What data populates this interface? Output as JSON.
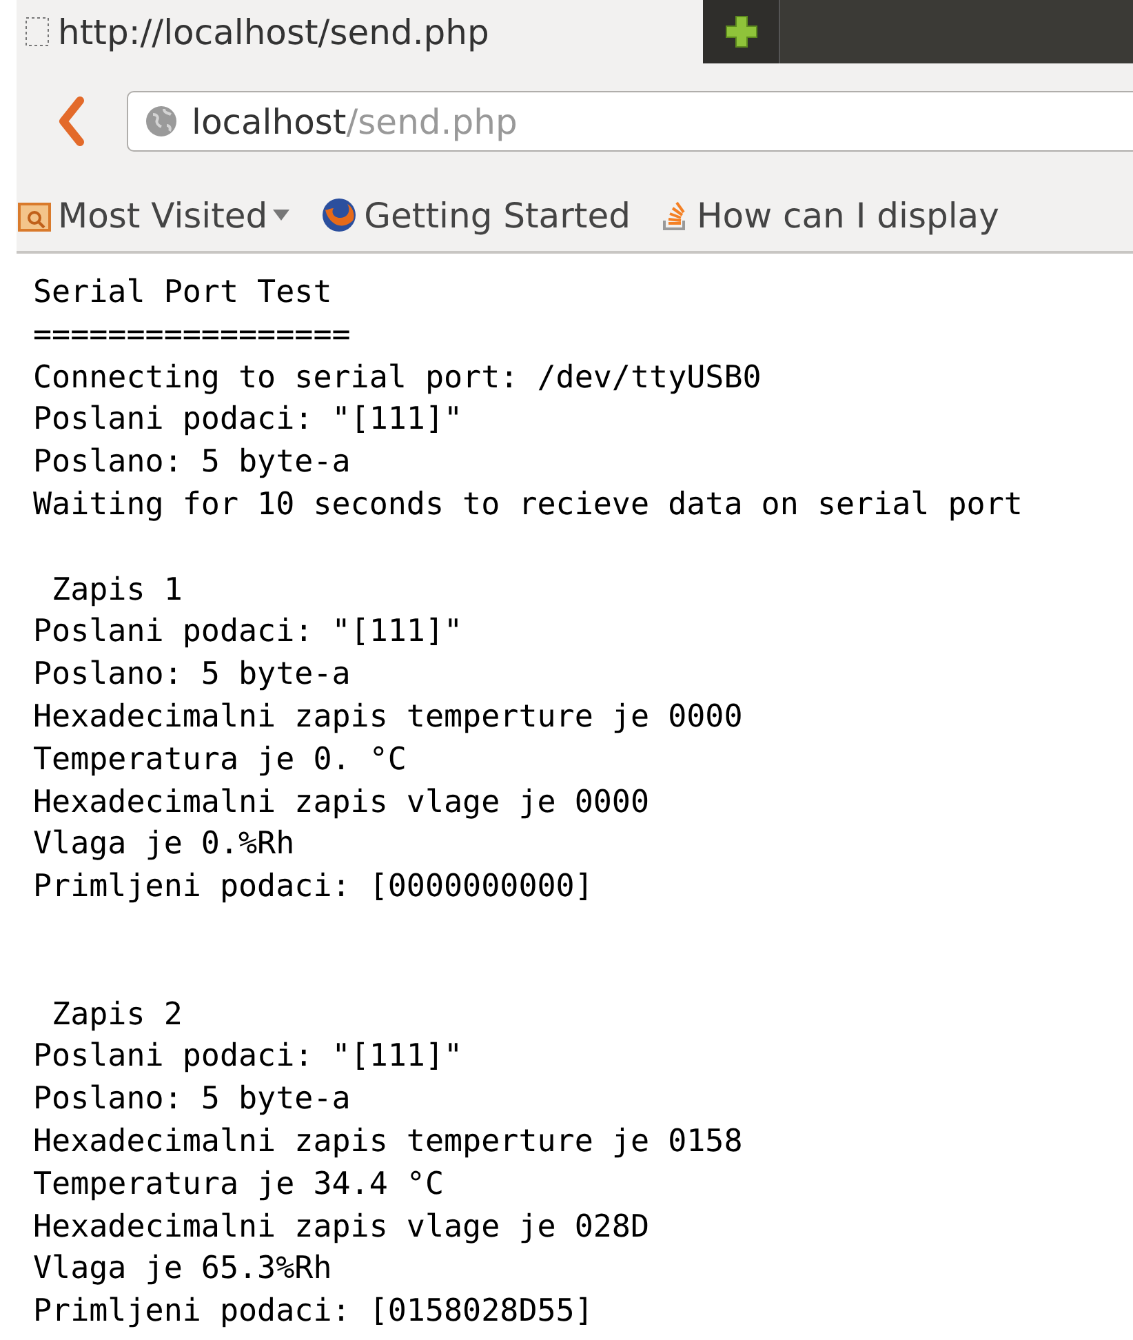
{
  "tab": {
    "title": "http://localhost/send.php"
  },
  "address_bar": {
    "host": "localhost",
    "path": "/send.php"
  },
  "bookmarks": [
    {
      "kind": "folder",
      "label": "Most Visited",
      "dropdown": true
    },
    {
      "kind": "firefox",
      "label": "Getting Started",
      "dropdown": false
    },
    {
      "kind": "stack",
      "label": "How can I display",
      "dropdown": false
    }
  ],
  "output": {
    "header_lines": [
      "Serial Port Test",
      "=================",
      "Connecting to serial port: /dev/ttyUSB0",
      "Poslani podaci: \"[111]\"",
      "Poslano: 5 byte-a",
      "Waiting for 10 seconds to recieve data on serial port"
    ],
    "records": [
      {
        "title": " Zapis 1",
        "lines": [
          "Poslani podaci: \"[111]\"",
          "Poslano: 5 byte-a",
          "Hexadecimalni zapis temperture je 0000",
          "Temperatura je 0. °C",
          "Hexadecimalni zapis vlage je 0000",
          "Vlaga je 0.%Rh",
          "Primljeni podaci: [0000000000]"
        ]
      },
      {
        "title": " Zapis 2",
        "lines": [
          "Poslani podaci: \"[111]\"",
          "Poslano: 5 byte-a",
          "Hexadecimalni zapis temperture je 0158",
          "Temperatura je 34.4 °C",
          "Hexadecimalni zapis vlage je 028D",
          "Vlaga je 65.3%Rh",
          "Primljeni podaci: [0158028D55]"
        ]
      }
    ]
  }
}
